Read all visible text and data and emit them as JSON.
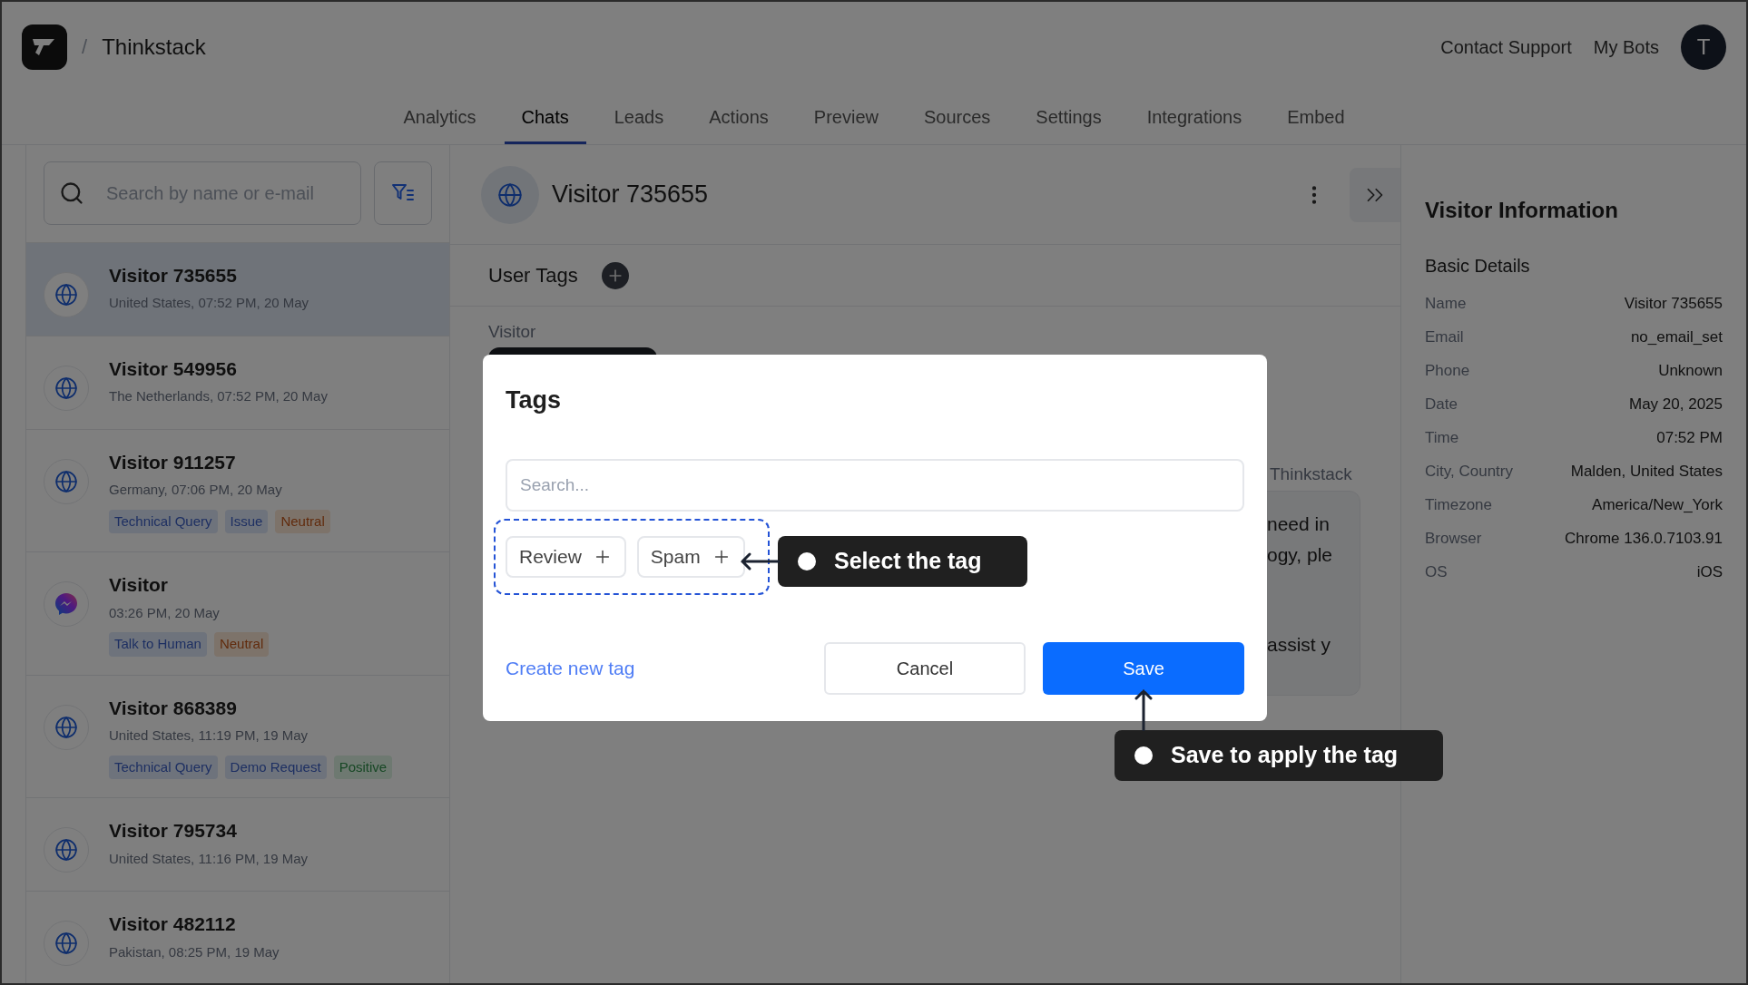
{
  "app": {
    "brand": "Thinkstack",
    "separator": "/",
    "links": [
      "Contact Support",
      "My Bots"
    ],
    "avatar": "T"
  },
  "nav_tabs": [
    {
      "label": "Analytics",
      "selected": false
    },
    {
      "label": "Chats",
      "selected": true
    },
    {
      "label": "Leads",
      "selected": false
    },
    {
      "label": "Actions",
      "selected": false
    },
    {
      "label": "Preview",
      "selected": false
    },
    {
      "label": "Sources",
      "selected": false
    },
    {
      "label": "Settings",
      "selected": false
    },
    {
      "label": "Integrations",
      "selected": false
    },
    {
      "label": "Embed",
      "selected": false
    }
  ],
  "chat_list": {
    "search": {
      "placeholder": "Search by name or e-mail"
    },
    "items": [
      {
        "name": "Visitor 735655",
        "meta": "United States, 07:52 PM, 20 May",
        "kind": "web",
        "selected": true
      },
      {
        "name": "Visitor 549956",
        "meta": "The Netherlands, 07:52 PM, 20 May",
        "kind": "web",
        "selected": false
      },
      {
        "name": "Visitor 911257",
        "meta": "Germany, 07:06 PM, 20 May",
        "kind": "web",
        "selected": false,
        "tags": [
          {
            "label": "Technical Query",
            "kind": "category"
          },
          {
            "label": "Issue",
            "kind": "category"
          },
          {
            "label": "Neutral",
            "kind": "neutral"
          }
        ]
      },
      {
        "name": "Visitor",
        "meta": "03:26 PM, 20 May",
        "kind": "messenger",
        "selected": false,
        "tags": [
          {
            "label": "Talk to Human",
            "kind": "category"
          },
          {
            "label": "Neutral",
            "kind": "neutral"
          }
        ]
      },
      {
        "name": "Visitor 868389",
        "meta": "United States, 11:19 PM, 19 May",
        "kind": "web",
        "selected": false,
        "tags": [
          {
            "label": "Technical Query",
            "kind": "category"
          },
          {
            "label": "Demo Request",
            "kind": "category"
          },
          {
            "label": "Positive",
            "kind": "positive"
          }
        ]
      },
      {
        "name": "Visitor 795734",
        "meta": "United States, 11:16 PM, 19 May",
        "kind": "web",
        "selected": false
      },
      {
        "name": "Visitor 482112",
        "meta": "Pakistan, 08:25 PM, 19 May",
        "kind": "web",
        "selected": false
      }
    ]
  },
  "conversation": {
    "title": "Visitor 735655",
    "user_tags_label": "User Tags",
    "sender_label": "Visitor",
    "bot_label": "Thinkstack",
    "message_fragments": [
      "need in",
      "ogy, ple",
      "assist y"
    ]
  },
  "visitor_info": {
    "title": "Visitor Information",
    "section": "Basic Details",
    "fields": [
      {
        "label": "Name",
        "value": "Visitor 735655"
      },
      {
        "label": "Email",
        "value": "no_email_set"
      },
      {
        "label": "Phone",
        "value": "Unknown"
      },
      {
        "label": "Date",
        "value": "May 20, 2025"
      },
      {
        "label": "Time",
        "value": "07:52 PM"
      },
      {
        "label": "City, Country",
        "value": "Malden, United States"
      },
      {
        "label": "Timezone",
        "value": "America/New_York"
      },
      {
        "label": "Browser",
        "value": "Chrome 136.0.7103.91"
      },
      {
        "label": "OS",
        "value": "iOS"
      }
    ]
  },
  "tags_dialog": {
    "title": "Tags",
    "search": {
      "placeholder": "Search..."
    },
    "tags": [
      "Review",
      "Spam"
    ],
    "create_link": "Create new tag",
    "buttons": [
      {
        "label": "Cancel",
        "kind": "secondary"
      },
      {
        "label": "Save",
        "kind": "primary"
      }
    ]
  },
  "callouts": [
    {
      "text": "Select the tag",
      "kind": "tags"
    },
    {
      "text": "Save to apply the tag",
      "kind": "save"
    }
  ]
}
